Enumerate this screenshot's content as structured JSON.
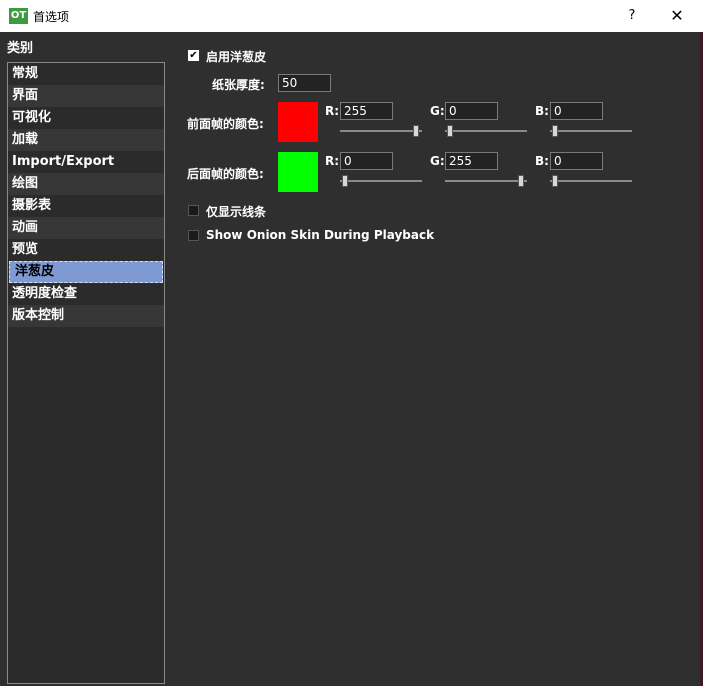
{
  "window": {
    "title": "首选项",
    "app_icon_text": "OT",
    "help_label": "?",
    "close_label": "✕"
  },
  "sidebar": {
    "header": "类别",
    "items": [
      {
        "label": "常规"
      },
      {
        "label": "界面"
      },
      {
        "label": "可视化"
      },
      {
        "label": "加载"
      },
      {
        "label": "Import/Export"
      },
      {
        "label": "绘图"
      },
      {
        "label": "摄影表"
      },
      {
        "label": "动画"
      },
      {
        "label": "预览"
      },
      {
        "label": "洋葱皮"
      },
      {
        "label": "透明度检查"
      },
      {
        "label": "版本控制"
      }
    ],
    "selected_index": 9
  },
  "onion": {
    "enable_label": "启用洋葱皮",
    "enable_checked": true,
    "paper_label": "纸张厚度:",
    "paper_value": "50",
    "front": {
      "label": "前面帧的颜色:",
      "color": "#ff0000",
      "r_label": "R:",
      "r": "255",
      "g_label": "G:",
      "g": "0",
      "b_label": "B:",
      "b": "0"
    },
    "back": {
      "label": "后面帧的颜色:",
      "color": "#00ff00",
      "r_label": "R:",
      "r": "0",
      "g_label": "G:",
      "g": "255",
      "b_label": "B:",
      "b": "0"
    },
    "lines_only_label": "仅显示线条",
    "lines_only_checked": false,
    "playback_label": "Show Onion Skin During Playback",
    "playback_checked": false
  },
  "colors": {
    "accent_selected": "#7f9ad3",
    "panel_bg": "#2f2f2f"
  }
}
